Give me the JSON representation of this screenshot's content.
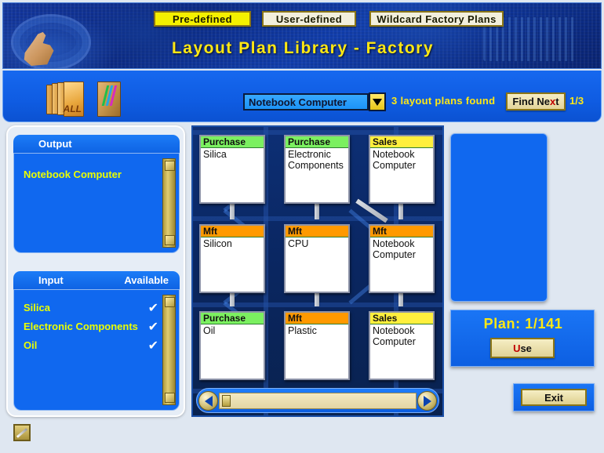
{
  "header": {
    "title": "Layout Plan Library - Factory",
    "tabs": [
      {
        "label": "Pre-defined",
        "active": true
      },
      {
        "label": "User-defined",
        "active": false
      },
      {
        "label": "Wildcard Factory Plans",
        "active": false
      }
    ]
  },
  "toolbar": {
    "all_books_label": "ALL",
    "filter_value": "Notebook Computer",
    "found_text": "3 layout plans found",
    "find_next_label": "Find Next",
    "find_next_accel": "x",
    "page_count": "1/3"
  },
  "left_panel": {
    "output": {
      "title": "Output",
      "items": [
        "Notebook Computer"
      ]
    },
    "input": {
      "title": "Input",
      "available_title": "Available",
      "items": [
        {
          "label": "Silica",
          "available": "✔"
        },
        {
          "label": "Electronic Components",
          "available": "✔"
        },
        {
          "label": "Oil",
          "available": "✔"
        }
      ]
    }
  },
  "grid": {
    "cards": [
      {
        "type": "Purchase",
        "name": "Silica"
      },
      {
        "type": "Purchase",
        "name": "Electronic Components"
      },
      {
        "type": "Sales",
        "name": "Notebook Computer"
      },
      {
        "type": "Mft",
        "name": "Silicon"
      },
      {
        "type": "Mft",
        "name": "CPU"
      },
      {
        "type": "Mft",
        "name": "Notebook Computer"
      },
      {
        "type": "Purchase",
        "name": "Oil"
      },
      {
        "type": "Mft",
        "name": "Plastic"
      },
      {
        "type": "Sales",
        "name": "Notebook Computer"
      }
    ]
  },
  "right_panel": {
    "plan_label": "Plan:  1/141",
    "use_label": "se",
    "use_accel": "U",
    "exit_label": "Exit"
  },
  "colors": {
    "purchase": "#7bf060",
    "mft": "#ff9900",
    "sales": "#ffef3d",
    "panel_blue": "#1068ef",
    "accent_yellow": "#ffe814"
  }
}
